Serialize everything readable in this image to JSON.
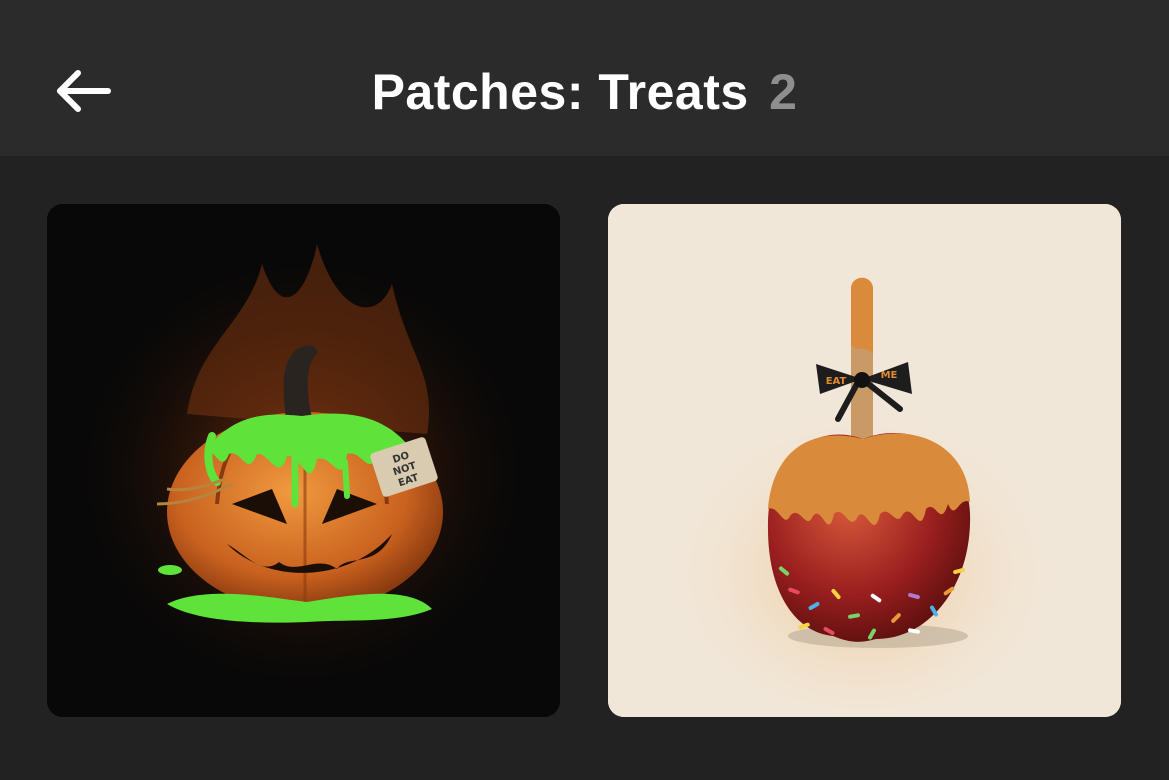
{
  "header": {
    "back_icon": "arrow-left-icon",
    "title": "Patches: Treats",
    "count": "2"
  },
  "patches": [
    {
      "name": "pumpkin",
      "tag_text_line1": "DO",
      "tag_text_line2": "NOT",
      "tag_text_line3": "EAT",
      "background": "#080808"
    },
    {
      "name": "candy-apple",
      "ribbon_left": "EAT",
      "ribbon_right": "ME",
      "background": "#f1e7d8"
    }
  ],
  "colors": {
    "header_bg": "#2b2b2b",
    "page_bg": "#232323",
    "title": "#ffffff",
    "count": "#8e8e8e",
    "slime": "#5fe33a",
    "pumpkin": "#d9782a",
    "caramel": "#d98a3a",
    "apple_red": "#9a1f1f"
  }
}
